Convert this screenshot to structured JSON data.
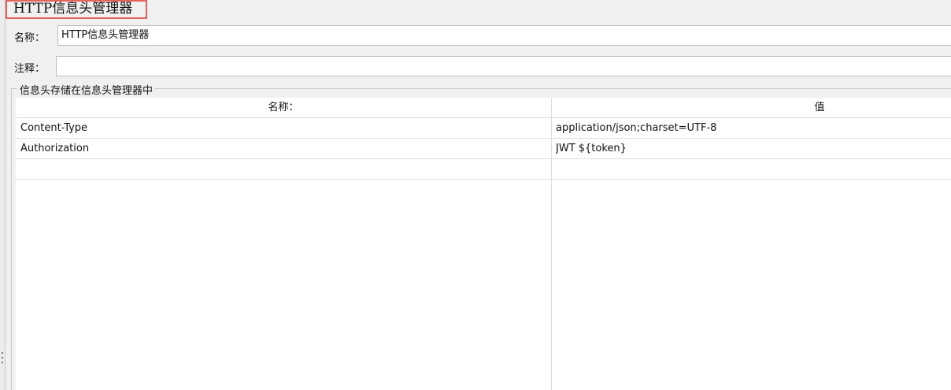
{
  "panel": {
    "title": "HTTP信息头管理器"
  },
  "form": {
    "name_label": "名称：",
    "name_value": "HTTP信息头管理器",
    "comment_label": "注释：",
    "comment_value": ""
  },
  "headers_group": {
    "title": "信息头存储在信息头管理器中",
    "columns": {
      "name": "名称：",
      "value": "值"
    },
    "rows": [
      {
        "name": "Content-Type",
        "value": "application/json;charset=UTF-8"
      },
      {
        "name": "Authorization",
        "value": "JWT ${token}"
      },
      {
        "name": "",
        "value": ""
      }
    ]
  },
  "colors": {
    "title_highlight": "#e5635d",
    "background": "#f0f0f0",
    "table_bg": "#ffffff"
  }
}
